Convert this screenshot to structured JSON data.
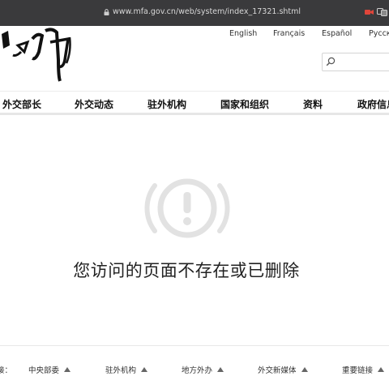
{
  "browser": {
    "url": "www.mfa.gov.cn/web/system/index_17321.shtml"
  },
  "header": {
    "languages": [
      "English",
      "Français",
      "Español",
      "Pусск"
    ],
    "search_placeholder": ""
  },
  "nav": [
    "外交部长",
    "外交动态",
    "驻外机构",
    "国家和组织",
    "资料",
    "政府信息"
  ],
  "error": {
    "message": "您访问的页面不存在或已删除"
  },
  "footer": {
    "lead": "接：",
    "items": [
      "中央部委",
      "驻外机构",
      "地方外办",
      "外交新媒体",
      "重要链接"
    ]
  }
}
